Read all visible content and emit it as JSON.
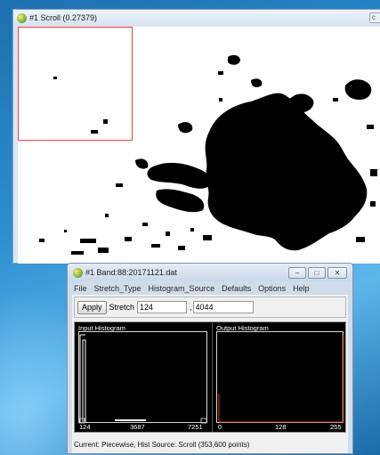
{
  "scroll_window": {
    "title": "#1 Scroll (0.27379)",
    "title_button": "c"
  },
  "band_window": {
    "title": "#1 Band:88:20171121.dat",
    "controls": {
      "minimize": "–",
      "maximize": "□",
      "close": "✕"
    },
    "menu": [
      "File",
      "Stretch_Type",
      "Histogram_Source",
      "Defaults",
      "Options",
      "Help"
    ],
    "toolbar": {
      "apply_label": "Apply",
      "stretch_label": "Stretch",
      "min_value": "124",
      "separator": ",",
      "max_value": "4044"
    },
    "input_histogram": {
      "label": "Input  Histogram",
      "ticks": [
        "124",
        "3687",
        "7251"
      ]
    },
    "output_histogram": {
      "label": "Output  Histogram",
      "ticks": [
        "0",
        "128",
        "255"
      ]
    },
    "status": "Current: Piecewise, Hist Source: Scroll (353,600 points)"
  },
  "colors": {
    "zoom_box": "#ff3b3b",
    "input_hist_line": "#ffffff",
    "output_hist_line": "#e03030",
    "desktop": "#2c8fd0"
  }
}
